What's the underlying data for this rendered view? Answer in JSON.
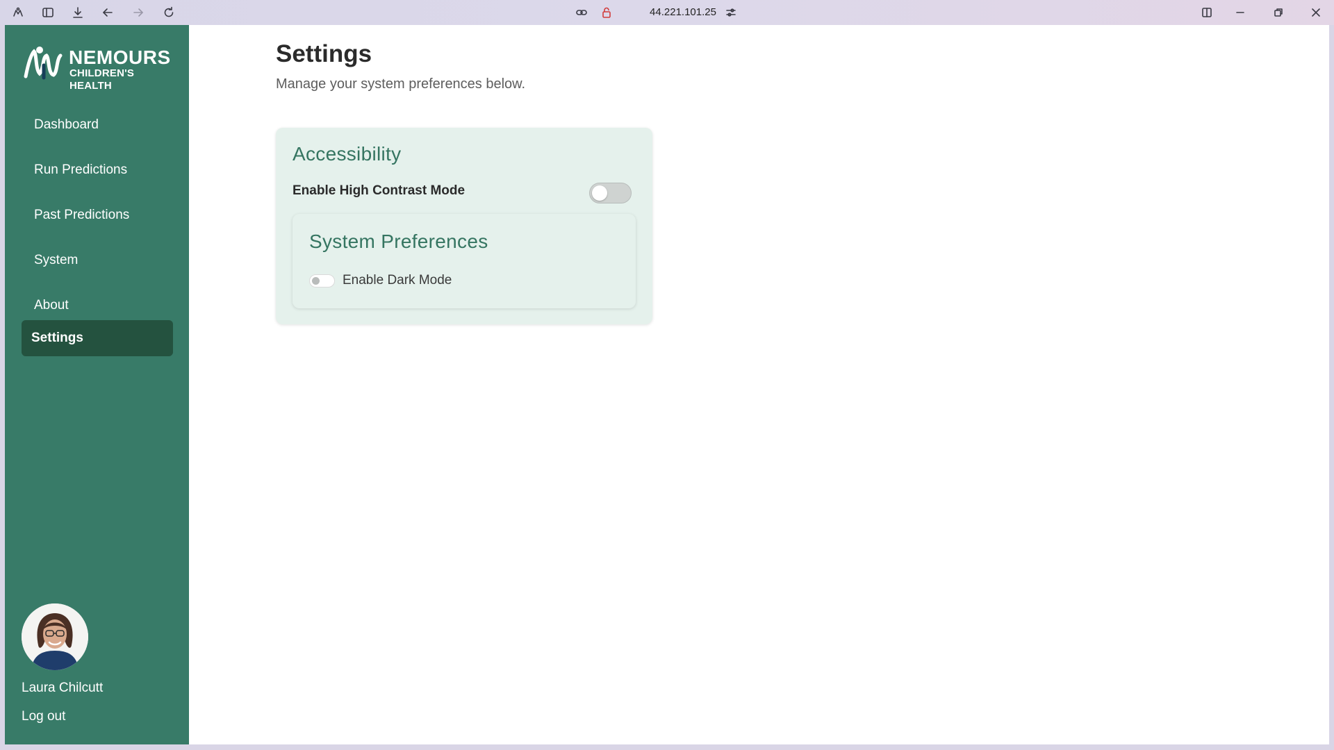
{
  "browser": {
    "url": "44.221.101.25",
    "icons": [
      "extensions-icon",
      "sidebar-toggle-icon",
      "download-icon",
      "back-arrow-icon",
      "forward-arrow-icon",
      "reload-icon",
      "link-icon",
      "lock-icon",
      "tune-icon",
      "split-view-icon",
      "minimize-icon",
      "restore-icon",
      "close-icon"
    ]
  },
  "brand": {
    "name": "NEMOURS",
    "subtitle": "CHILDREN'S HEALTH"
  },
  "sidebar": {
    "items": [
      {
        "label": "Dashboard",
        "active": false
      },
      {
        "label": "Run Predictions",
        "active": false
      },
      {
        "label": "Past Predictions",
        "active": false
      },
      {
        "label": "System",
        "active": false
      },
      {
        "label": "About",
        "active": false
      },
      {
        "label": "Settings",
        "active": true
      }
    ]
  },
  "user": {
    "name": "Laura Chilcutt",
    "logout_label": "Log out"
  },
  "page": {
    "title": "Settings",
    "subtitle": "Manage your system preferences below."
  },
  "accessibility": {
    "title": "Accessibility",
    "high_contrast_label": "Enable High Contrast Mode",
    "high_contrast_on": false
  },
  "system_preferences": {
    "title": "System Preferences",
    "dark_mode_label": "Enable Dark Mode",
    "dark_mode_on": false
  },
  "colors": {
    "sidebar": "#387b68",
    "sidebar_active": "#24523f",
    "accent_text": "#357561",
    "card_bg": "#e5f1ec"
  }
}
